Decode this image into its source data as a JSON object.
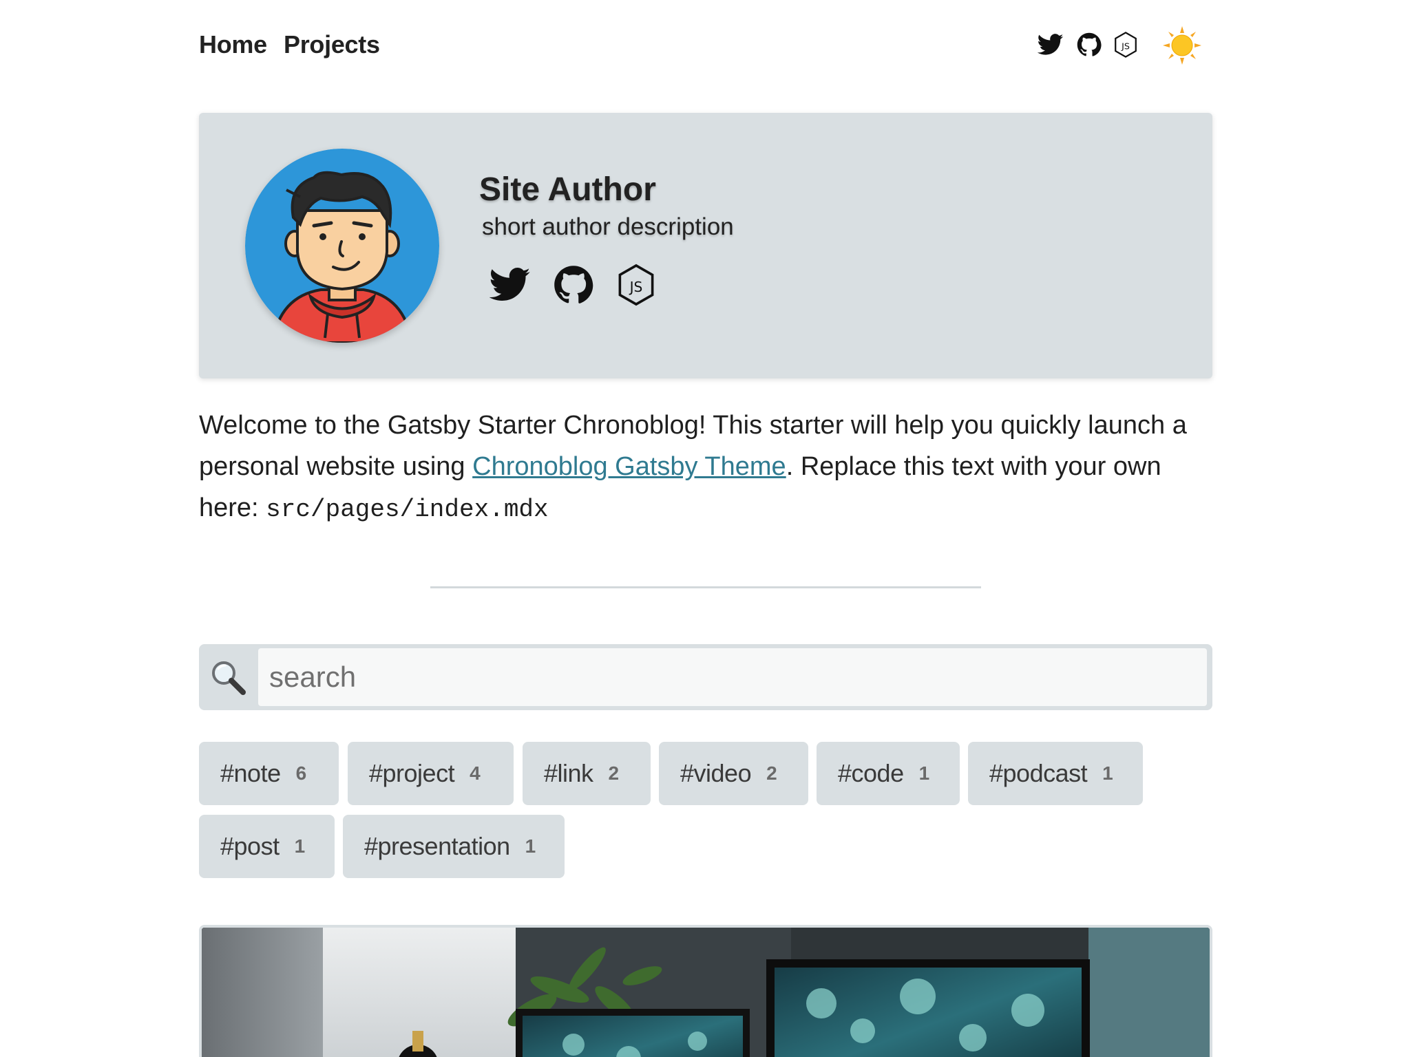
{
  "nav": {
    "home": "Home",
    "projects": "Projects",
    "icons": [
      "twitter-icon",
      "github-icon",
      "nodejs-icon",
      "sun-icon"
    ]
  },
  "author": {
    "name": "Site Author",
    "description": "short author description",
    "avatar": "cartoon-avatar",
    "social_icons": [
      "twitter-icon",
      "github-icon",
      "nodejs-icon"
    ]
  },
  "intro": {
    "text_before": "Welcome to the Gatsby Starter Chronoblog! This starter will help you quickly launch a personal website using ",
    "link_text": "Chronoblog Gatsby Theme",
    "text_after": ". Replace this text with your own here: ",
    "code": "src/pages/index.mdx"
  },
  "search": {
    "placeholder": "search",
    "value": ""
  },
  "tags": [
    {
      "label": "#note",
      "count": "6"
    },
    {
      "label": "#project",
      "count": "4"
    },
    {
      "label": "#link",
      "count": "2"
    },
    {
      "label": "#video",
      "count": "2"
    },
    {
      "label": "#code",
      "count": "1"
    },
    {
      "label": "#podcast",
      "count": "1"
    },
    {
      "label": "#post",
      "count": "1"
    },
    {
      "label": "#presentation",
      "count": "1"
    }
  ],
  "colors": {
    "card_bg": "#d9dfe2",
    "link": "#2f7a90",
    "text": "#1f1f1f"
  }
}
